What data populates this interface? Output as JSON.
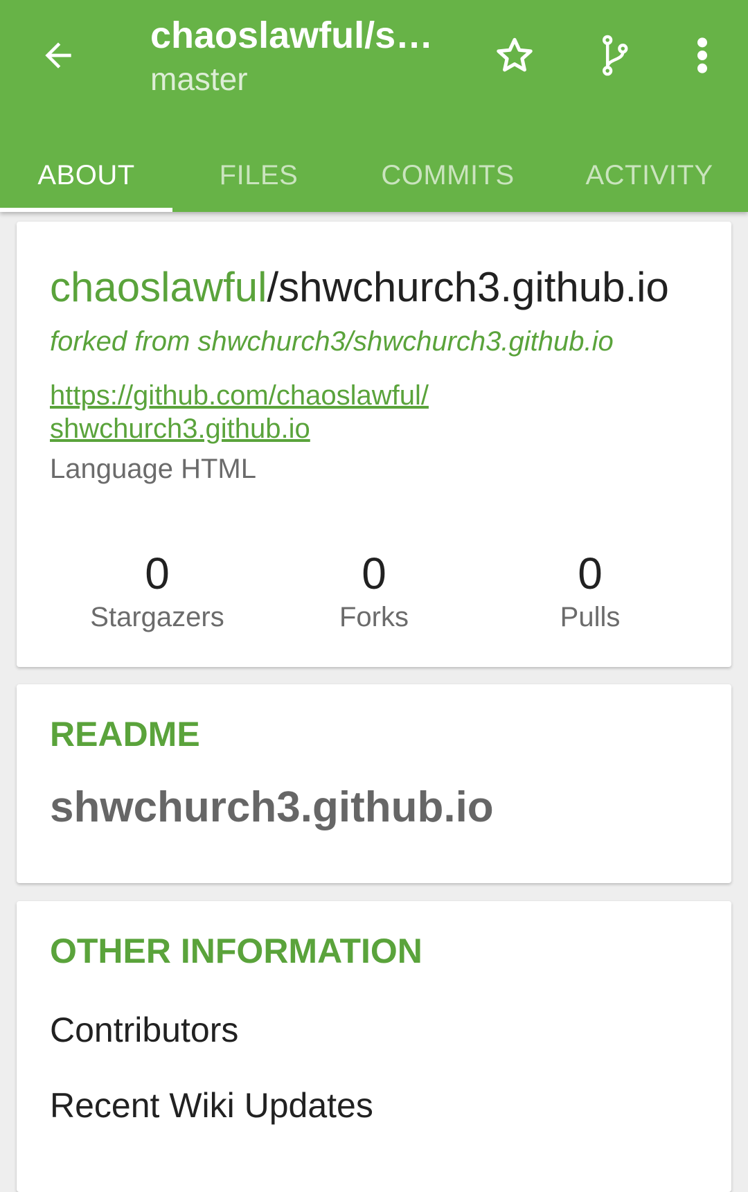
{
  "appbar": {
    "title": "chaoslawful/s…",
    "subtitle": "master",
    "background_color": "#67b347",
    "icons": {
      "back": "arrow-back-icon",
      "star": "star-outline-icon",
      "branch": "branch-icon",
      "overflow": "more-vert-icon"
    }
  },
  "tabs": [
    {
      "label": "ABOUT",
      "active": true
    },
    {
      "label": "FILES",
      "active": false
    },
    {
      "label": "COMMITS",
      "active": false
    },
    {
      "label": "ACTIVITY",
      "active": false
    }
  ],
  "about": {
    "owner": "chaoslawful",
    "repo": "/shwchurch3.github.io",
    "forked_from": "forked from shwchurch3/shwchurch3.github.io",
    "url_line1": "https://github.com/chaoslawful/",
    "url_line2": "shwchurch3.github.io",
    "language": "Language HTML",
    "stats": [
      {
        "value": "0",
        "label": "Stargazers"
      },
      {
        "value": "0",
        "label": "Forks"
      },
      {
        "value": "0",
        "label": "Pulls"
      }
    ]
  },
  "readme": {
    "header": "README",
    "title": "shwchurch3.github.io"
  },
  "other_info": {
    "header": "OTHER INFORMATION",
    "items": [
      "Contributors",
      "Recent Wiki Updates"
    ]
  },
  "colors": {
    "accent": "#5aa33b",
    "text_primary": "#212121",
    "text_secondary": "#6b6b6b"
  }
}
